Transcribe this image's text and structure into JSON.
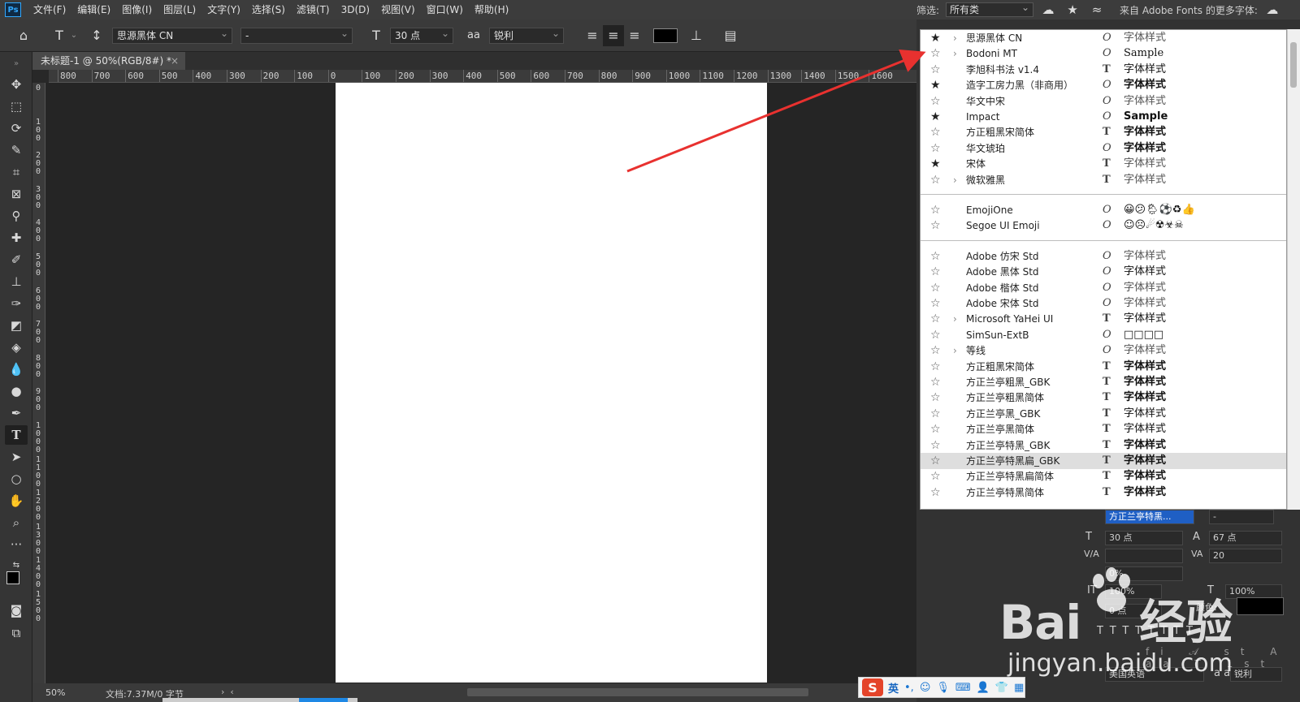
{
  "app": {
    "logo": "Ps"
  },
  "menu": [
    "文件(F)",
    "编辑(E)",
    "图像(I)",
    "图层(L)",
    "文字(Y)",
    "选择(S)",
    "滤镜(T)",
    "3D(D)",
    "视图(V)",
    "窗口(W)",
    "帮助(H)"
  ],
  "filter": {
    "label": "筛选:",
    "value": "所有类",
    "more_fonts": "来自 Adobe Fonts 的更多字体:"
  },
  "options": {
    "font_family": "思源黑体 CN",
    "font_style": "-",
    "font_size": "30 点",
    "antialias": "锐利",
    "text_color": "#000000"
  },
  "document": {
    "tab_title": "未标题-1 @ 50%(RGB/8#) *",
    "zoom": "50%",
    "doc_info": "文档:7.37M/0 字节"
  },
  "ruler": {
    "h_labels": [
      "800",
      "700",
      "600",
      "500",
      "400",
      "300",
      "200",
      "100",
      "0",
      "100",
      "200",
      "300",
      "400",
      "500",
      "600",
      "700",
      "800",
      "900",
      "1000",
      "1100",
      "1200",
      "1300",
      "1400",
      "1500",
      "1600"
    ],
    "v_labels": [
      "0",
      "1 0 0",
      "2 0 0",
      "3 0 0",
      "4 0 0",
      "5 0 0",
      "6 0 0",
      "7 0 0",
      "8 0 0",
      "9 0 0",
      "1 0 0 0",
      "1 1 0 0",
      "1 2 0 0",
      "1 3 0 0",
      "1 4 0 0",
      "1 5 0 0"
    ]
  },
  "font_list": {
    "group1": [
      {
        "name": "思源黑体 CN",
        "fav": true,
        "expand": true,
        "type": "O",
        "sample": "字体样式",
        "style": "light"
      },
      {
        "name": "Bodoni MT",
        "fav": false,
        "expand": true,
        "type": "O",
        "sample": "Sample",
        "style": "serif"
      },
      {
        "name": "李旭科书法 v1.4",
        "fav": false,
        "expand": false,
        "type": "T",
        "sample": "字体样式",
        "style": "serif"
      },
      {
        "name": "造字工房力黑（非商用）",
        "fav": true,
        "expand": false,
        "type": "O",
        "sample": "字体样式",
        "style": "bold"
      },
      {
        "name": "华文中宋",
        "fav": false,
        "expand": false,
        "type": "O",
        "sample": "字体样式",
        "style": "light"
      },
      {
        "name": "Impact",
        "fav": true,
        "expand": false,
        "type": "O",
        "sample": "Sample",
        "style": "bold"
      },
      {
        "name": "方正粗黑宋简体",
        "fav": false,
        "expand": false,
        "type": "T",
        "sample": "字体样式",
        "style": "bold"
      },
      {
        "name": "华文琥珀",
        "fav": false,
        "expand": false,
        "type": "O",
        "sample": "字体样式",
        "style": "bold"
      },
      {
        "name": "宋体",
        "fav": true,
        "expand": false,
        "type": "T",
        "sample": "字体样式",
        "style": "light"
      },
      {
        "name": "微软雅黑",
        "fav": false,
        "expand": true,
        "type": "T",
        "sample": "字体样式",
        "style": "light"
      }
    ],
    "group2": [
      {
        "name": "EmojiOne",
        "fav": false,
        "expand": false,
        "type": "O",
        "sample": "😀😕🌦⚽♻👍",
        "style": ""
      },
      {
        "name": "Segoe UI Emoji",
        "fav": false,
        "expand": false,
        "type": "O",
        "sample": "☺☹☄☢☣☠",
        "style": ""
      }
    ],
    "group3": [
      {
        "name": "Adobe 仿宋 Std",
        "fav": false,
        "expand": false,
        "type": "O",
        "sample": "字体样式",
        "style": "light"
      },
      {
        "name": "Adobe 黑体 Std",
        "fav": false,
        "expand": false,
        "type": "O",
        "sample": "字体样式",
        "style": ""
      },
      {
        "name": "Adobe 楷体 Std",
        "fav": false,
        "expand": false,
        "type": "O",
        "sample": "字体样式",
        "style": "light"
      },
      {
        "name": "Adobe 宋体 Std",
        "fav": false,
        "expand": false,
        "type": "O",
        "sample": "字体样式",
        "style": "light"
      },
      {
        "name": "Microsoft YaHei UI",
        "fav": false,
        "expand": true,
        "type": "T",
        "sample": "字体样式",
        "style": ""
      },
      {
        "name": "SimSun-ExtB",
        "fav": false,
        "expand": false,
        "type": "O",
        "sample": "□□□□",
        "style": ""
      },
      {
        "name": "等线",
        "fav": false,
        "expand": true,
        "type": "O",
        "sample": "字体样式",
        "style": "light"
      },
      {
        "name": "方正粗黑宋简体",
        "fav": false,
        "expand": false,
        "type": "T",
        "sample": "字体样式",
        "style": "bold"
      },
      {
        "name": "方正兰亭粗黑_GBK",
        "fav": false,
        "expand": false,
        "type": "T",
        "sample": "字体样式",
        "style": "bold"
      },
      {
        "name": "方正兰亭粗黑简体",
        "fav": false,
        "expand": false,
        "type": "T",
        "sample": "字体样式",
        "style": "bold"
      },
      {
        "name": "方正兰亭黑_GBK",
        "fav": false,
        "expand": false,
        "type": "T",
        "sample": "字体样式",
        "style": ""
      },
      {
        "name": "方正兰亭黑简体",
        "fav": false,
        "expand": false,
        "type": "T",
        "sample": "字体样式",
        "style": ""
      },
      {
        "name": "方正兰亭特黑_GBK",
        "fav": false,
        "expand": false,
        "type": "T",
        "sample": "字体样式",
        "style": "bold"
      },
      {
        "name": "方正兰亭特黑扁_GBK",
        "fav": false,
        "expand": false,
        "type": "T",
        "sample": "字体样式",
        "style": "bold",
        "selected": true
      },
      {
        "name": "方正兰亭特黑扁简体",
        "fav": false,
        "expand": false,
        "type": "T",
        "sample": "字体样式",
        "style": "bold"
      },
      {
        "name": "方正兰亭特黑简体",
        "fav": false,
        "expand": false,
        "type": "T",
        "sample": "字体样式",
        "style": "bold"
      }
    ]
  },
  "char_panel": {
    "font": "方正兰亭特黑...",
    "style": "-",
    "size": "30 点",
    "leading": "67 点",
    "kerning": "",
    "tracking": "20",
    "vscale_pct": "0%",
    "hscale": "100%",
    "vscale": "100%",
    "baseline": "0 点",
    "color_label": "颜色:",
    "language": "美国英语",
    "aa_icon": "a a",
    "antialias": "锐利",
    "ot_row": "fi 𝒜 st A aa T 1st ½"
  },
  "watermark": {
    "main": "Bai",
    "main2": "经验",
    "sub": "jingyan.baidu.com"
  },
  "ime": {
    "lang": "英"
  }
}
